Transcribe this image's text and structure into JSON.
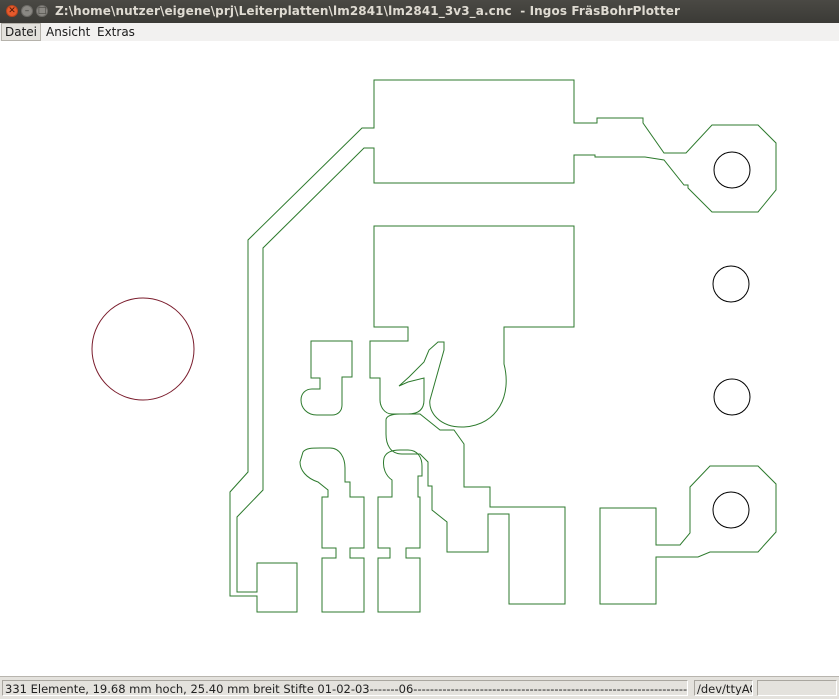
{
  "window": {
    "title": "Z:\\home\\nutzer\\eigene\\prj\\Leiterplatten\\lm2841\\lm2841_3v3_a.cnc  - Ingos FräsBohrPlotter",
    "close_glyph": "✕",
    "min_glyph": "–",
    "max_glyph": "□"
  },
  "menu": {
    "file": "Datei",
    "view": "Ansicht",
    "extras": "Extras"
  },
  "statusbar": {
    "info": "331 Elemente, 19.68 mm hoch, 25.40 mm breit Stifte 01-02-03-------06------------------------------------------------------------------------------------------------",
    "port": "/dev/ttyAC"
  },
  "colors": {
    "trace": "#2d7a2d",
    "drill": "#000000",
    "fiducial": "#7a1c2c"
  }
}
